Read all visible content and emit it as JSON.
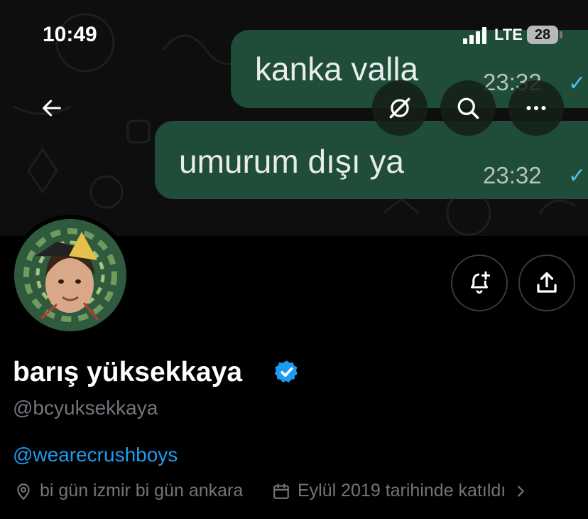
{
  "status_bar": {
    "time": "10:49",
    "network": "LTE",
    "battery": "28"
  },
  "banner": {
    "messages": [
      {
        "text": "kanka valla",
        "time": "23:32",
        "status": "read-ticks"
      },
      {
        "text": "umurum dışı ya",
        "time": "23:32",
        "status": "read-ticks"
      }
    ],
    "bubble_color": "#1f4d3a"
  },
  "header_buttons": {
    "back": "back-arrow-icon",
    "grok": "grok-icon",
    "search": "search-icon",
    "more": "more-icon"
  },
  "profile": {
    "display_name": "barış yüksekkaya",
    "handle": "@bcyuksekkaya",
    "bio_link": "@wearecrushboys",
    "location": "bi gün izmir bi gün ankara",
    "joined": "Eylül 2019 tarihinde katıldı",
    "verified_color": "#1d9bf0",
    "link_color": "#1d9bf0"
  },
  "actions": {
    "notify": "bell-plus-icon",
    "share": "share-icon"
  }
}
